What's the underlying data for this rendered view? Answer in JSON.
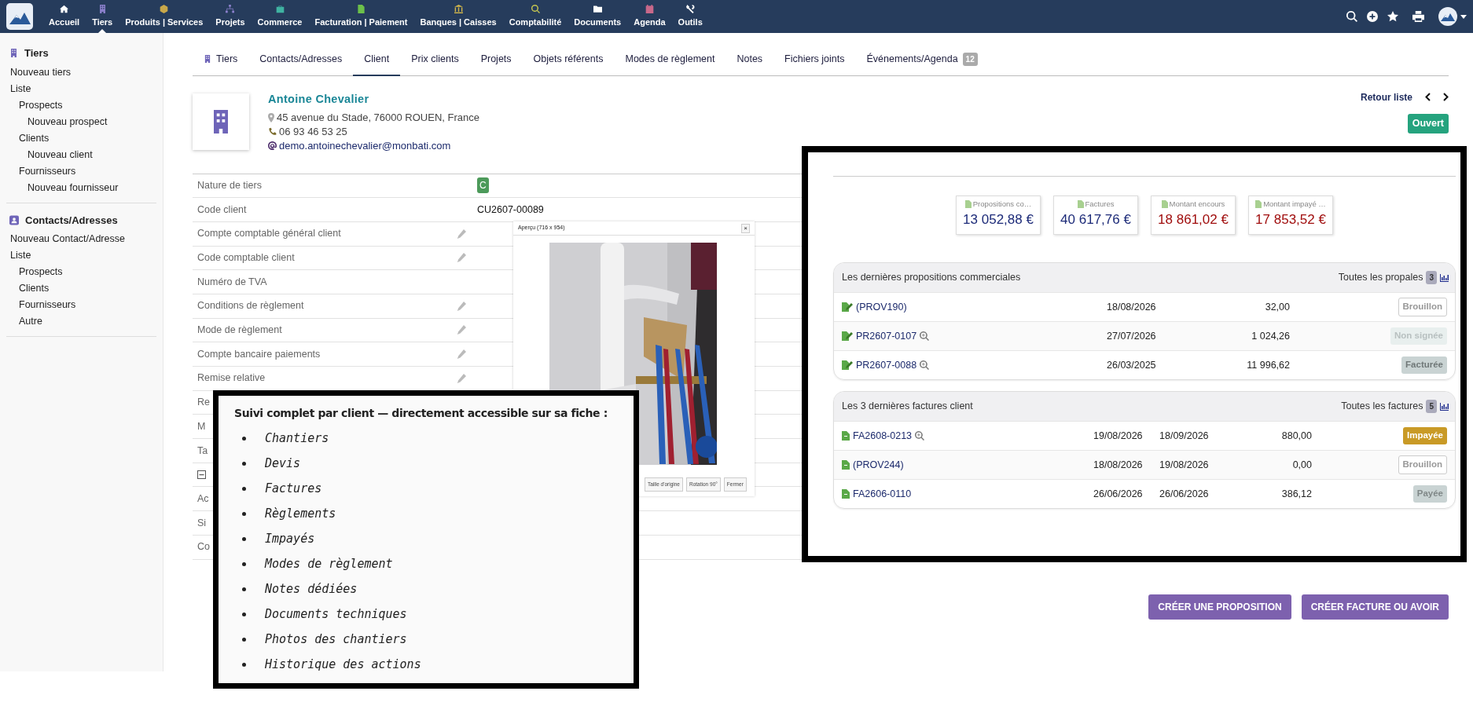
{
  "navbar": {
    "menu": [
      {
        "label": "Accueil",
        "selected": false
      },
      {
        "label": "Tiers",
        "selected": true
      },
      {
        "label": "Produits | Services",
        "selected": false
      },
      {
        "label": "Projets",
        "selected": false
      },
      {
        "label": "Commerce",
        "selected": false
      },
      {
        "label": "Facturation | Paiement",
        "selected": false
      },
      {
        "label": "Banques | Caisses",
        "selected": false
      },
      {
        "label": "Comptabilité",
        "selected": false
      },
      {
        "label": "Documents",
        "selected": false
      },
      {
        "label": "Agenda",
        "selected": false
      },
      {
        "label": "Outils",
        "selected": false
      }
    ]
  },
  "sidebar": [
    {
      "title": "Tiers",
      "items": [
        {
          "label": "Nouveau tiers"
        },
        {
          "label": "Liste",
          "children": [
            {
              "label": "Prospects",
              "children": [
                {
                  "label": "Nouveau prospect"
                }
              ]
            },
            {
              "label": "Clients",
              "children": [
                {
                  "label": "Nouveau client"
                }
              ]
            },
            {
              "label": "Fournisseurs",
              "children": [
                {
                  "label": "Nouveau fournisseur"
                }
              ]
            }
          ]
        }
      ]
    },
    {
      "title": "Contacts/Adresses",
      "items": [
        {
          "label": "Nouveau Contact/Adresse"
        },
        {
          "label": "Liste",
          "children": [
            {
              "label": "Prospects"
            },
            {
              "label": "Clients"
            },
            {
              "label": "Fournisseurs"
            },
            {
              "label": "Autre"
            }
          ]
        }
      ]
    }
  ],
  "tabs": [
    {
      "label": "Tiers",
      "selected": false
    },
    {
      "label": "Contacts/Adresses",
      "selected": false
    },
    {
      "label": "Client",
      "selected": true
    },
    {
      "label": "Prix clients",
      "selected": false
    },
    {
      "label": "Projets",
      "selected": false
    },
    {
      "label": "Objets référents",
      "selected": false
    },
    {
      "label": "Modes de règlement",
      "selected": false
    },
    {
      "label": "Notes",
      "selected": false
    },
    {
      "label": "Fichiers joints",
      "selected": false
    },
    {
      "label": "Événements/Agenda",
      "selected": false,
      "badge": "12"
    }
  ],
  "company": {
    "name": "Antoine Chevalier",
    "address": "45 avenue du Stade, 76000 ROUEN, France",
    "phone": "06 93 46 53 25",
    "email": "demo.antoinechevalier@monbati.com"
  },
  "record_nav": {
    "back": "Retour liste"
  },
  "status": "Ouvert",
  "fields": [
    {
      "kind": "text",
      "label": "Nature de tiers",
      "value_badge": "C",
      "editable": false
    },
    {
      "kind": "text",
      "label": "Code client",
      "value": "CU2607-00089",
      "editable": false
    },
    {
      "kind": "text",
      "label": "Compte comptable général client",
      "editable": true
    },
    {
      "kind": "text",
      "label": "Code comptable client",
      "editable": true
    },
    {
      "kind": "text",
      "label": "Numéro de TVA",
      "editable": false
    },
    {
      "kind": "text",
      "label": "Conditions de règlement",
      "editable": true
    },
    {
      "kind": "text",
      "label": "Mode de règlement",
      "editable": true
    },
    {
      "kind": "text",
      "label": "Compte bancaire paiements",
      "editable": true
    },
    {
      "kind": "text",
      "label": "Remise relative",
      "editable": true
    },
    {
      "kind": "text",
      "label": "Re",
      "editable": false
    },
    {
      "kind": "text",
      "label": "M",
      "editable": false
    },
    {
      "kind": "text",
      "label": "Ta",
      "editable": false
    },
    {
      "kind": "toggle",
      "editable": false
    },
    {
      "kind": "text",
      "label": "Ac",
      "editable": false
    },
    {
      "kind": "text",
      "label": "Si",
      "editable": false
    },
    {
      "kind": "text",
      "label": "Co",
      "editable": false
    }
  ],
  "preview": {
    "title": "Aperçu (716 x 954)",
    "close": "×",
    "buttons": [
      "Taille d'origine",
      "Rotation 90°",
      "Fermer"
    ]
  },
  "callout": {
    "heading": "Suivi complet par client — directement accessible sur sa fiche :",
    "items": [
      "Chantiers",
      "Devis",
      "Factures",
      "Règlements",
      "Impayés",
      "Modes de règlement",
      "Notes dédiées",
      "Documents techniques",
      "Photos des chantiers",
      "Historique des actions"
    ]
  },
  "summary": {
    "kpis": [
      {
        "label": "Propositions co…",
        "value": "13 052,88 €",
        "color": "#1c2a78"
      },
      {
        "label": "Factures",
        "value": "40 617,76 €",
        "color": "#1c2a78"
      },
      {
        "label": "Montant encours",
        "value": "18 861,02 €",
        "color": "#a00d0d"
      },
      {
        "label": "Montant impayé …",
        "value": "17 853,52 €",
        "color": "#a00d0d"
      }
    ],
    "proposals": {
      "title": "Les dernières propositions commerciales",
      "link": "Toutes les propales",
      "count": "3",
      "rows": [
        {
          "ref": "(PROV190)",
          "preview": false,
          "date": "18/08/2026",
          "amount": "32,00",
          "status": "Brouillon",
          "kind": "draft"
        },
        {
          "ref": "PR2607-0107",
          "preview": true,
          "date": "27/07/2026",
          "amount": "1 024,26",
          "status": "Non signée",
          "kind": "unsigned"
        },
        {
          "ref": "PR2607-0088",
          "preview": true,
          "date": "26/03/2025",
          "amount": "11 996,62",
          "status": "Facturée",
          "kind": "billed"
        }
      ]
    },
    "invoices": {
      "title": "Les 3 dernières factures client",
      "link": "Toutes les factures",
      "count": "5",
      "rows": [
        {
          "ref": "FA2608-0213",
          "preview": true,
          "date": "19/08/2026",
          "due": "18/09/2026",
          "amount": "880,00",
          "status": "Impayée",
          "kind": "unpaid"
        },
        {
          "ref": "(PROV244)",
          "preview": false,
          "date": "18/08/2026",
          "due": "19/08/2026",
          "amount": "0,00",
          "status": "Brouillon",
          "kind": "draft"
        },
        {
          "ref": "FA2606-0110",
          "preview": false,
          "date": "26/06/2026",
          "due": "26/06/2026",
          "amount": "386,12",
          "status": "Payée",
          "kind": "paid"
        }
      ]
    }
  },
  "actions": [
    "CRÉER UNE PROPOSITION",
    "CRÉER FACTURE OU AVOIR"
  ]
}
